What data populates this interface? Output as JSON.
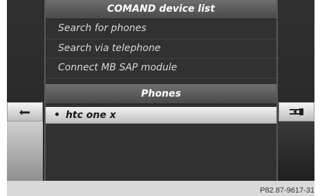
{
  "header": {
    "title": "COMAND device list"
  },
  "menu": {
    "items": [
      {
        "label": "Search for phones"
      },
      {
        "label": "Search via telephone"
      },
      {
        "label": "Connect MB SAP module"
      }
    ]
  },
  "phones": {
    "header": "Phones",
    "items": [
      {
        "bullet": "•",
        "label": "htc one x",
        "selected": true
      }
    ]
  },
  "icons": {
    "left": "back-arrow-icon",
    "right": "menu-exit-icon"
  },
  "caption": "P82.87-9617-31"
}
